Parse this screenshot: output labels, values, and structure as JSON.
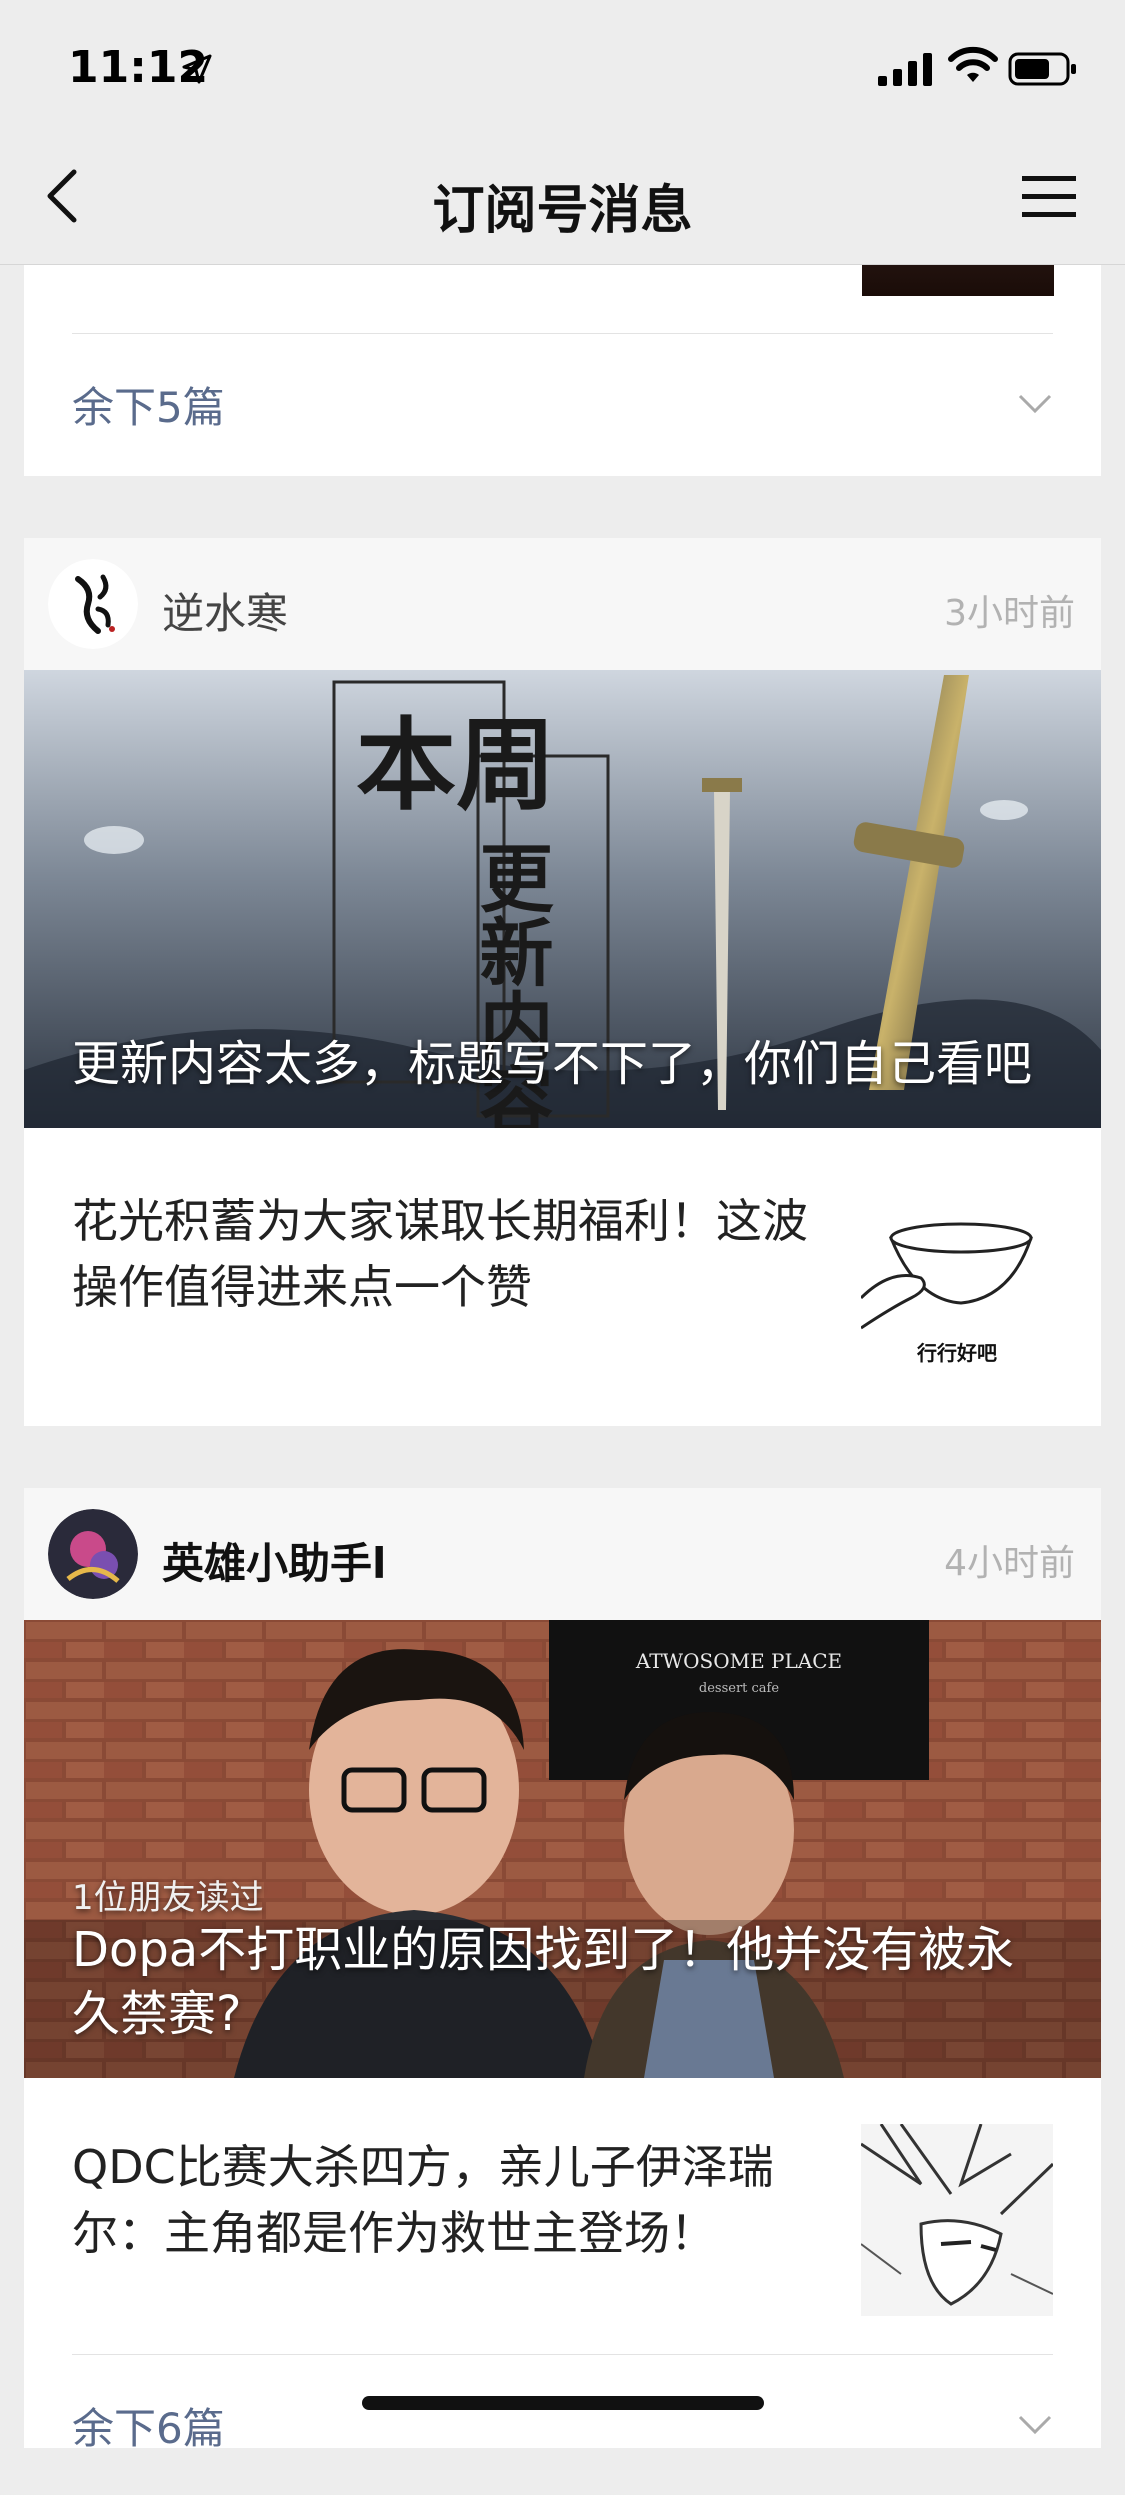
{
  "status_bar": {
    "time": "11:12"
  },
  "nav": {
    "title": "订阅号消息"
  },
  "cards": [
    {
      "more_label": "余下5篇"
    },
    {
      "account": "逆水寒",
      "time": "3小时前",
      "hero_title": "更新内容太多，标题写不下了，你们自己看吧",
      "hero_image_text": {
        "main": "本周",
        "sub": "更新内容"
      },
      "article_title": "花光积蓄为大家谋取长期福利！这波操作值得进来点一个赞",
      "article_thumb_caption": "行行好吧"
    },
    {
      "account": "英雄小助手l",
      "time": "4小时前",
      "hero_sub": "1位朋友读过",
      "hero_title": "Dopa不打职业的原因找到了！他并没有被永久禁赛?",
      "hero_sign": "ATWOSOME PLACE",
      "hero_sign_sub": "dessert cafe",
      "article_title": "QDC比赛大杀四方，亲儿子伊泽瑞尔：主角都是作为救世主登场！",
      "more_label": "余下6篇"
    }
  ],
  "colors": {
    "background": "#ededed",
    "link": "#5a6b8c",
    "time": "#b2b2b2"
  }
}
